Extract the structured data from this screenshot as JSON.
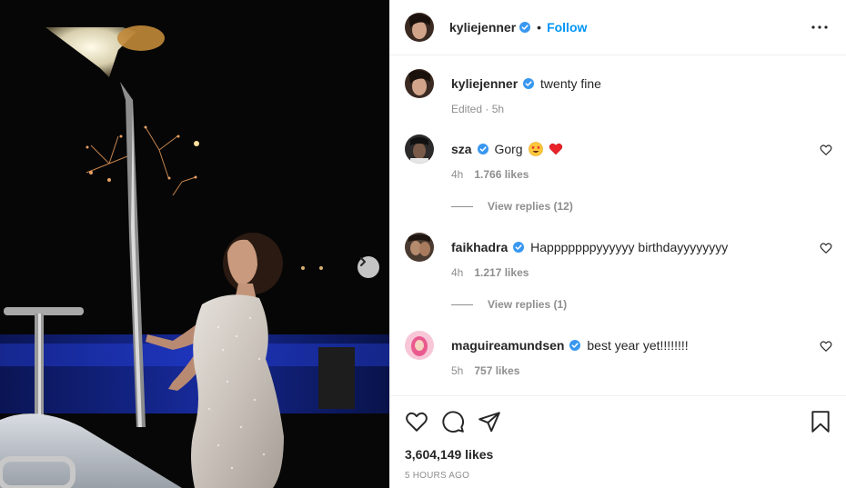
{
  "post": {
    "author": "kyliejenner",
    "follow_label": "Follow",
    "separator": "•",
    "caption": {
      "username": "kyliejenner",
      "text": "twenty fine",
      "meta": "Edited · 5h"
    },
    "comments": [
      {
        "username": "sza",
        "text": "Gorg",
        "emoji": [
          "star-struck-emoji",
          "red-heart-emoji"
        ],
        "time": "4h",
        "likes": "1.766 likes",
        "replies": "View replies (12)"
      },
      {
        "username": "faikhadra",
        "text": "Happpppppyyyyyy birthdayyyyyyyy",
        "time": "4h",
        "likes": "1.217 likes",
        "replies": "View replies (1)"
      },
      {
        "username": "maguireamundsen",
        "text": "best year yet!!!!!!!!",
        "time": "5h",
        "likes": "757 likes"
      }
    ],
    "like_count": "3,604,149 likes",
    "posted": "5 HOURS AGO"
  },
  "icons": {
    "verified_color": "#3897f0",
    "follow_color": "#0095f6",
    "heart_red": "#ed4956"
  }
}
